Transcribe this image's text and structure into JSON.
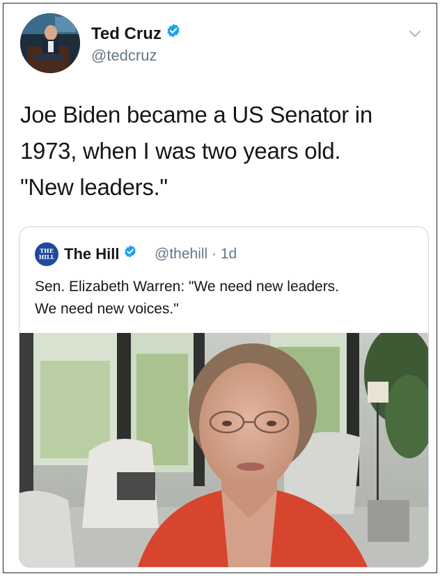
{
  "tweet": {
    "author_name": "Ted Cruz",
    "author_handle": "@tedcruz",
    "text_lines": [
      "Joe Biden became a US Senator in",
      "1973, when I was two years old.",
      "\"New leaders.\""
    ]
  },
  "quoted_tweet": {
    "logo_text": "THE HILL",
    "author_name": "The Hill",
    "author_handle": "@thehill",
    "separator": "·",
    "time": "1d",
    "text_lines": [
      "Sen. Elizabeth Warren: \"We need new leaders.",
      "We need new voices.\""
    ]
  },
  "icons": {
    "verified": "verified-badge-icon",
    "menu": "chevron-down-icon"
  },
  "colors": {
    "verified_blue": "#1da1f2",
    "handle_gray": "#657786",
    "border_gray": "#ccd6dd",
    "jacket_red": "#d8452e"
  }
}
